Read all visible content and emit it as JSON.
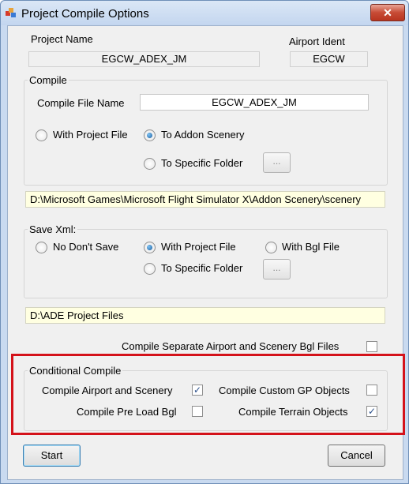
{
  "window": {
    "title": "Project Compile Options",
    "close_glyph": "✕",
    "app_icon": "app-icon"
  },
  "project": {
    "name_label": "Project Name",
    "name_value": "EGCW_ADEX_JM",
    "ident_label": "Airport Ident",
    "ident_value": "EGCW"
  },
  "compile": {
    "group_label": "Compile",
    "file_name_label": "Compile File Name",
    "file_name_value": "EGCW_ADEX_JM",
    "options": {
      "with_project_file": "With Project File",
      "to_addon_scenery": "To Addon Scenery",
      "to_specific_folder": "To Specific Folder"
    },
    "selected": "to_addon_scenery",
    "browse_label": "...",
    "path": "D:\\Microsoft Games\\Microsoft Flight Simulator X\\Addon Scenery\\scenery"
  },
  "save_xml": {
    "group_label": "Save Xml:",
    "options": {
      "no_dont_save": "No Don't Save",
      "with_project_file": "With Project File",
      "with_bgl_file": "With Bgl File",
      "to_specific_folder": "To Specific Folder"
    },
    "selected": "with_project_file",
    "browse_label": "...",
    "path": "D:\\ADE Project Files"
  },
  "separate_bgl": {
    "label": "Compile Separate Airport and Scenery Bgl Files",
    "checked": false
  },
  "conditional": {
    "group_label": "Conditional Compile",
    "items": [
      {
        "label": "Compile Airport and Scenery",
        "checked": true
      },
      {
        "label": "Compile Custom GP Objects",
        "checked": false
      },
      {
        "label": "Compile Pre Load Bgl",
        "checked": false
      },
      {
        "label": "Compile Terrain Objects",
        "checked": true
      }
    ],
    "highlight_color": "#d4121a"
  },
  "buttons": {
    "start": "Start",
    "cancel": "Cancel"
  }
}
